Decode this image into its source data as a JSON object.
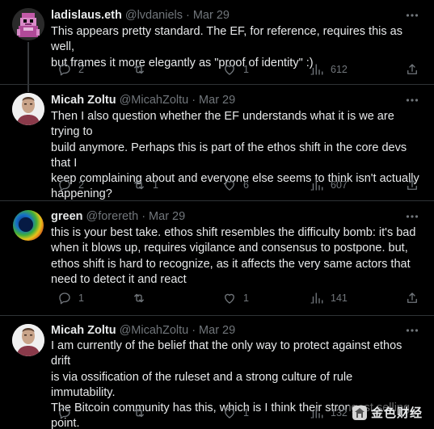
{
  "tweets": [
    {
      "name": "ladislaus.eth",
      "handle": "@lvdaniels",
      "separator": "·",
      "date": "Mar 29",
      "text": "This appears pretty standard. The EF, for reference, requires this as well,\nbut frames it more elegantly as \"proof of identity\" :)",
      "replies": "2",
      "retweets": "",
      "likes": "1",
      "views": "612",
      "avatar_icon": "pixel-art-avatar"
    },
    {
      "name": "Micah Zoltu",
      "handle": "@MicahZoltu",
      "separator": "·",
      "date": "Mar 29",
      "text": "Then I also question whether the EF understands what it is we are trying to\nbuild anymore.  Perhaps this is part of the ethos shift in the core devs that I\nkeep complaining about and everyone else seems to think isn't actually\nhappening?",
      "replies": "2",
      "retweets": "1",
      "likes": "6",
      "views": "607",
      "avatar_icon": "portrait-avatar"
    },
    {
      "name": "green",
      "handle": "@forereth",
      "separator": "·",
      "date": "Mar 29",
      "text": "this is your best take. ethos shift resembles the difficulty bomb: it's bad\nwhen it blows up, requires vigilance and consensus to postpone. but,\nethos shift is hard to recognize, as it affects the very same actors that\nneed to detect it and react",
      "replies": "1",
      "retweets": "",
      "likes": "1",
      "views": "141",
      "avatar_icon": "orb-avatar"
    },
    {
      "name": "Micah Zoltu",
      "handle": "@MicahZoltu",
      "separator": "·",
      "date": "Mar 29",
      "text": "I am currently of the belief that the only way to protect against ethos drift\nis via ossification of the ruleset and a strong culture of rule immutability.\nThe Bitcoin community has this, which is I think their strongest selling\npoint.",
      "replies": "",
      "retweets": "",
      "likes": "1",
      "views": "132",
      "avatar_icon": "portrait-avatar"
    }
  ],
  "watermark": {
    "text": "金色财经",
    "icon": "jinse-logo-icon"
  },
  "colors": {
    "background": "#000000",
    "text": "#e7e9ea",
    "muted": "#71767b",
    "divider": "#2f3336",
    "thread_line": "#333639"
  }
}
